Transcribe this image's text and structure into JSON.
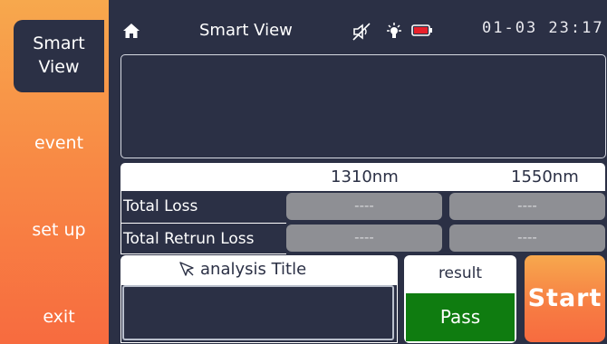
{
  "sidebar": {
    "items": [
      {
        "label_line1": "Smart",
        "label_line2": "View"
      },
      {
        "label": "event"
      },
      {
        "label": "set up"
      },
      {
        "label": "exit"
      }
    ]
  },
  "header": {
    "title": "Smart View",
    "datetime": "01-03 23:17",
    "icons": [
      "home-icon",
      "mute-icon",
      "bulb-icon",
      "battery-icon"
    ]
  },
  "loss_table": {
    "columns": [
      "1310nm",
      "1550nm"
    ],
    "rows": [
      {
        "label": "Total Loss",
        "values": [
          "----",
          "----"
        ]
      },
      {
        "label": "Total Retrun Loss",
        "values": [
          "----",
          "----"
        ]
      }
    ]
  },
  "analysis": {
    "title_label": "analysis Title",
    "value": ""
  },
  "result": {
    "label": "result",
    "value": "Pass"
  },
  "start_button": {
    "label": "Start"
  },
  "colors": {
    "background": "#2b3045",
    "accent": "#f88b45",
    "pass": "#0f7c10",
    "value_box": "#8e8f94"
  }
}
